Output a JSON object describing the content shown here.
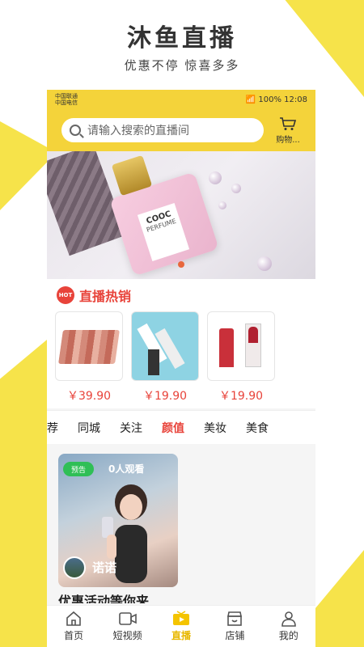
{
  "promo": {
    "title": "沐鱼直播",
    "subtitle": "优惠不停 惊喜多多"
  },
  "status_bar": {
    "carrier1": "中国联通",
    "carrier2": "中国电信",
    "battery": "100%",
    "time": "12:08"
  },
  "search": {
    "placeholder": "请输入搜索的直播间"
  },
  "cart": {
    "label": "购物..."
  },
  "banner": {
    "label_brand": "COOC",
    "label_text": "PERFUME"
  },
  "hot_sales": {
    "icon_text": "HOT",
    "title": "直播热销",
    "products": [
      {
        "price": "￥39.90"
      },
      {
        "price": "￥19.90"
      },
      {
        "price": "￥19.90"
      }
    ]
  },
  "tabs": {
    "items": [
      {
        "label": "荐"
      },
      {
        "label": "同城"
      },
      {
        "label": "关注"
      },
      {
        "label": "颜值"
      },
      {
        "label": "美妆"
      },
      {
        "label": "美食"
      }
    ],
    "active": "颜值"
  },
  "feed": {
    "cards": [
      {
        "badge": "预告",
        "viewers": "0人观看",
        "name": "诺诺",
        "caption": "优惠活动等你来"
      }
    ]
  },
  "bottom_nav": {
    "items": [
      {
        "label": "首页",
        "icon": "home-icon"
      },
      {
        "label": "短视频",
        "icon": "video-icon"
      },
      {
        "label": "直播",
        "icon": "live-icon"
      },
      {
        "label": "店铺",
        "icon": "shop-icon"
      },
      {
        "label": "我的",
        "icon": "user-icon"
      }
    ],
    "active": "直播"
  },
  "colors": {
    "accent_yellow": "#f4d33a",
    "price_red": "#e8433a",
    "badge_green": "#2fbf56"
  }
}
